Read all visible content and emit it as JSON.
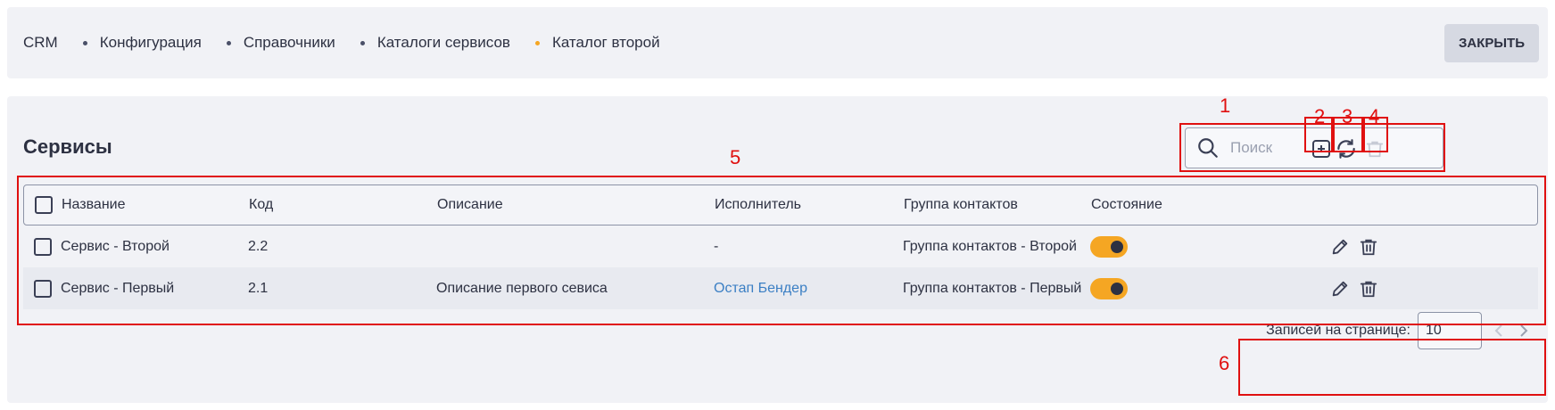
{
  "breadcrumbs": [
    {
      "label": "CRM"
    },
    {
      "label": "Конфигурация"
    },
    {
      "label": "Справочники"
    },
    {
      "label": "Каталоги сервисов"
    },
    {
      "label": "Каталог второй"
    }
  ],
  "header": {
    "close_label": "ЗАКРЫТЬ"
  },
  "section": {
    "title": "Сервисы"
  },
  "search": {
    "placeholder": "Поиск",
    "value": ""
  },
  "icons": {
    "search": "search-icon",
    "add": "plus-square-icon",
    "refresh": "refresh-icon",
    "delete": "trash-icon",
    "edit": "pencil-icon"
  },
  "table": {
    "columns": [
      "Название",
      "Код",
      "Описание",
      "Исполнитель",
      "Группа контактов",
      "Состояние"
    ],
    "rows": [
      {
        "name": "Сервис - Второй",
        "code": "2.2",
        "description": "",
        "executor": "-",
        "group": "Группа контактов - Второй",
        "active": true
      },
      {
        "name": "Сервис - Первый",
        "code": "2.1",
        "description": "Описание первого севиса",
        "executor": "Остап Бендер",
        "group": "Группа контактов - Первый",
        "active": true
      }
    ]
  },
  "pagination": {
    "label": "Записей на странице:",
    "page_size": "10"
  },
  "annotations": [
    "1",
    "2",
    "3",
    "4",
    "5",
    "6"
  ],
  "colors": {
    "accent": "#f5a623",
    "link": "#3b7fc4",
    "annotation": "#e01010"
  }
}
